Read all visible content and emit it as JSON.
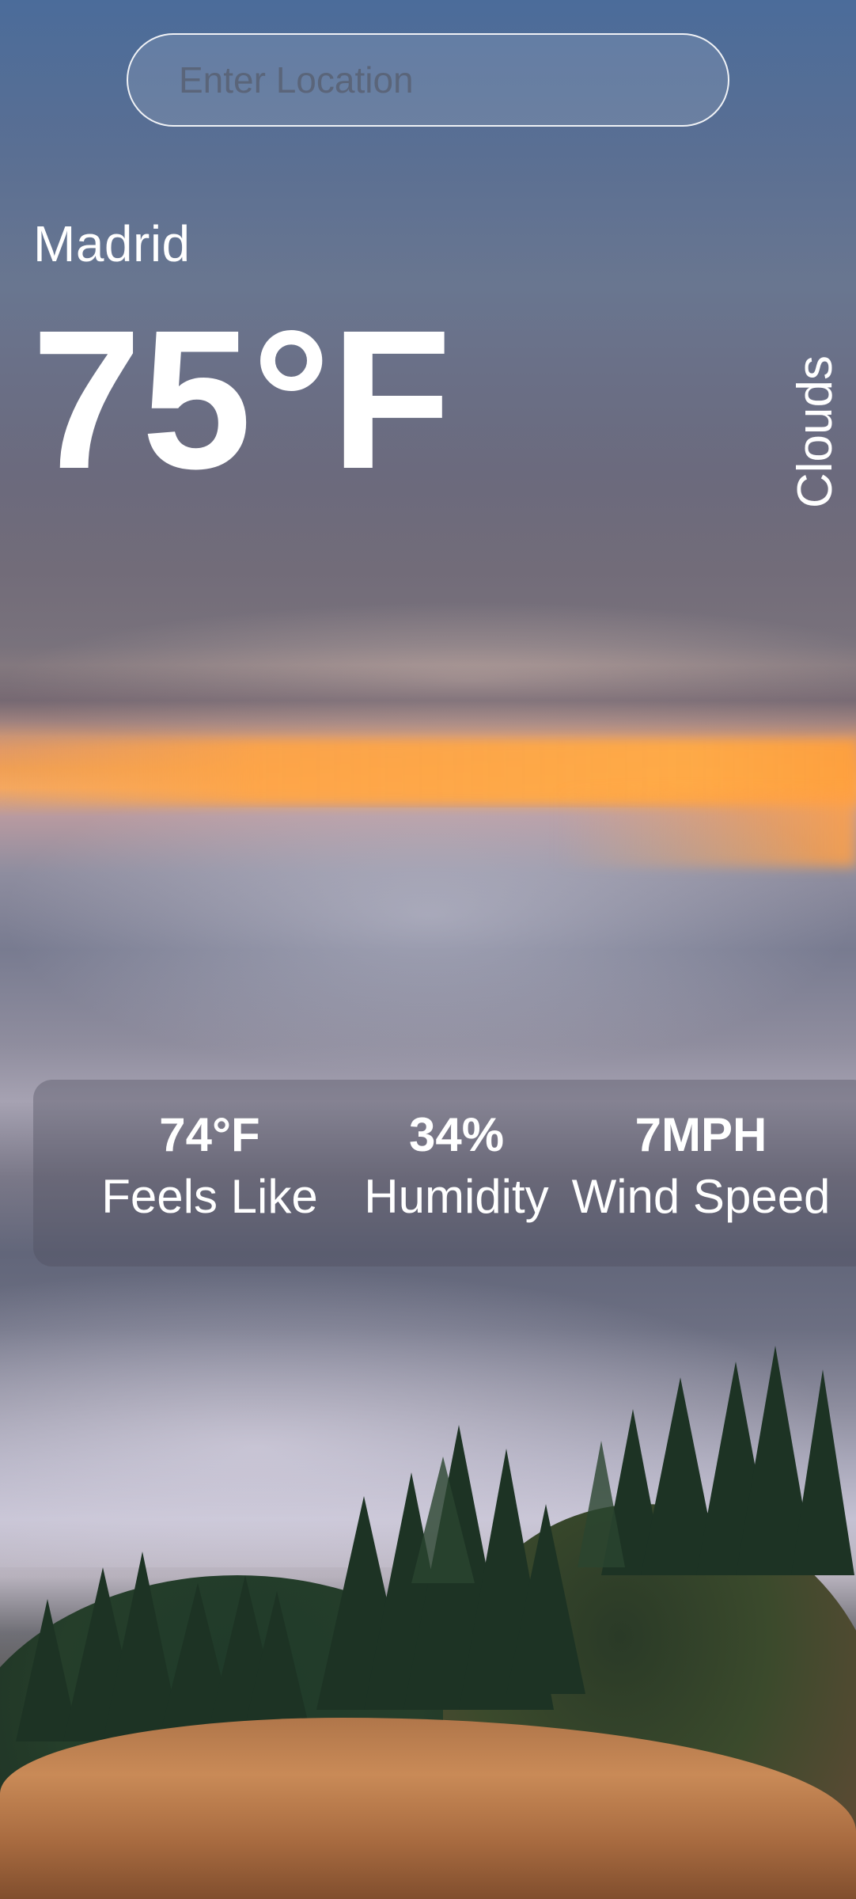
{
  "search": {
    "placeholder": "Enter Location",
    "value": ""
  },
  "weather": {
    "city": "Madrid",
    "temperature": "75°F",
    "condition": "Clouds"
  },
  "details": [
    {
      "value": "74°F",
      "label": "Feels Like"
    },
    {
      "value": "34%",
      "label": "Humidity"
    },
    {
      "value": "7MPH",
      "label": "Wind Speed"
    }
  ],
  "theme": {
    "text_color": "#ffffff",
    "panel_color": "rgba(80,80,95,0.38)",
    "sunset_color": "#f5a860"
  }
}
